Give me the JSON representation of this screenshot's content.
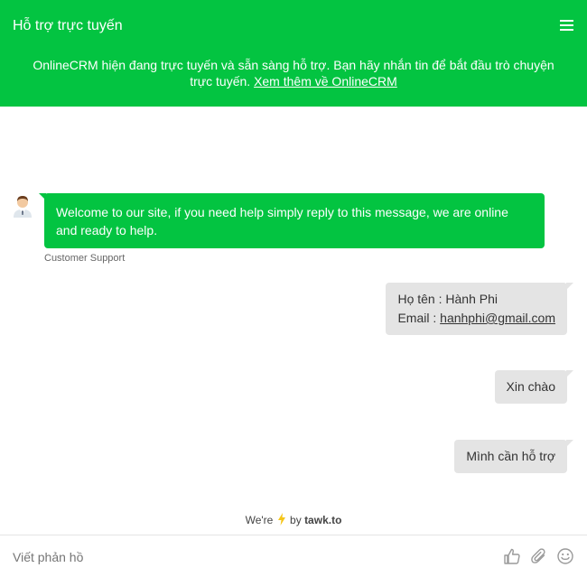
{
  "header": {
    "title": "Hỗ trợ trực tuyến",
    "description": "OnlineCRM hiện đang trực tuyến và sẵn sàng hỗ trợ. Bạn hãy nhắn tin để bắt đầu trò chuyện trực tuyến.",
    "link_text": "Xem thêm về OnlineCRM"
  },
  "chat": {
    "agent_message": "Welcome to our site, if you need help simply reply to this message, we are online and ready to help.",
    "agent_name": "Customer Support",
    "visitor_messages": {
      "info_name": "Họ tên : Hành Phi",
      "info_email_label": "Email : ",
      "info_email": "hanhphi@gmail.com",
      "greeting": "Xin chào",
      "request": "Mình cần hỗ trợ"
    }
  },
  "branding": {
    "prefix": "We're",
    "middle": "by",
    "name": "tawk.to"
  },
  "composer": {
    "placeholder": "Viết phản hồ"
  },
  "colors": {
    "accent": "#03c441",
    "visitor_bubble": "#e4e4e4",
    "bolt": "#f5c518"
  },
  "icons": [
    "menu-icon",
    "agent-avatar-icon",
    "bolt-icon",
    "thumbs-up-icon",
    "paperclip-icon",
    "emoji-icon"
  ]
}
